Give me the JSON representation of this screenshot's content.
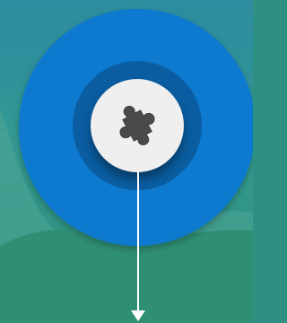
{
  "icons": {
    "center": "puzzle-piece-icon",
    "connector": "down-arrow-icon"
  },
  "colors": {
    "background_top": "#2d8f9e",
    "background_mid": "#3a9b8f",
    "background_bottom": "#2d8e77",
    "outer_ring": "#0879cf",
    "inner_ring": "#0a5da0",
    "center_disc": "#efefef",
    "puzzle_piece": "#4a4a4a",
    "arrow": "#ffffff"
  }
}
